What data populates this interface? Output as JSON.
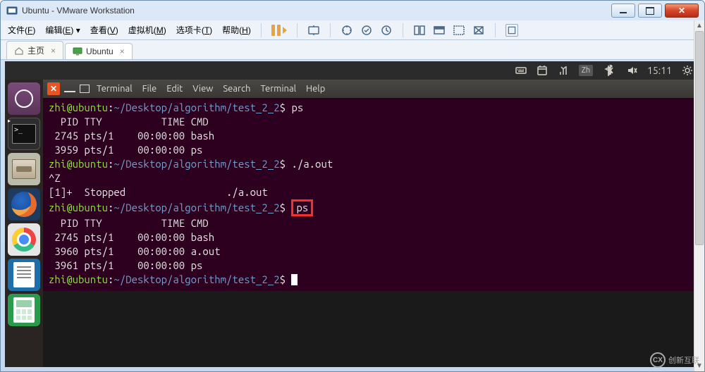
{
  "window": {
    "title": "Ubuntu - VMware Workstation"
  },
  "menubar": {
    "items": [
      {
        "label": "文件",
        "mnemonic": "F"
      },
      {
        "label": "编辑",
        "mnemonic": "E"
      },
      {
        "label": "查看",
        "mnemonic": "V"
      },
      {
        "label": "虚拟机",
        "mnemonic": "M"
      },
      {
        "label": "选项卡",
        "mnemonic": "T"
      },
      {
        "label": "帮助",
        "mnemonic": "H"
      }
    ]
  },
  "tabs": {
    "home_label": "主页",
    "vm_label": "Ubuntu"
  },
  "unity": {
    "ime_badge": "Zh",
    "clock": "15:11",
    "launcher": {
      "term_prompt": ">_"
    }
  },
  "terminal": {
    "window_controls": {
      "close_glyph": "✕"
    },
    "menus": [
      "Terminal",
      "File",
      "Edit",
      "View",
      "Search",
      "Terminal",
      "Help"
    ],
    "prompt_user": "zhi@ubuntu",
    "prompt_path": "~/Desktop/algorithm/test_2_2",
    "prompt_sep": ":",
    "prompt_end": "$ ",
    "lines": {
      "cmd1": "ps",
      "hdr": "  PID TTY          TIME CMD",
      "p1": " 2745 pts/1    00:00:00 bash",
      "p2": " 3959 pts/1    00:00:00 ps",
      "cmd2": "./a.out",
      "ctrlz": "^Z",
      "stopped": "[1]+  Stopped                 ./a.out",
      "cmd3": "ps",
      "hdr2": "  PID TTY          TIME CMD",
      "p3": " 2745 pts/1    00:00:00 bash",
      "p4": " 3960 pts/1    00:00:00 a.out",
      "p5": " 3961 pts/1    00:00:00 ps"
    }
  },
  "watermark": {
    "text": "创新互联",
    "logo": "CX"
  }
}
